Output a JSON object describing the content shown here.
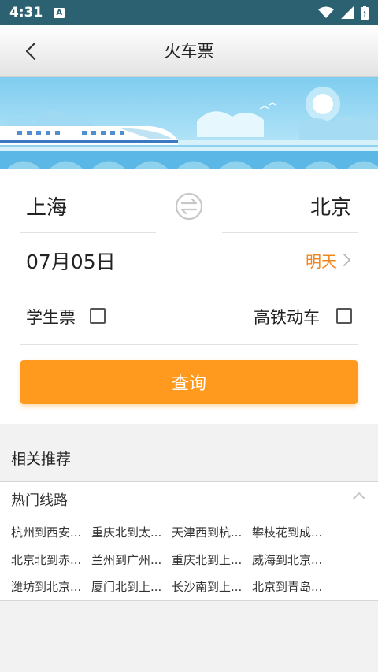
{
  "status_bar": {
    "time": "4:31",
    "notification_icon_letter": "A",
    "icons": [
      "wifi-icon",
      "signal-icon",
      "battery-icon"
    ]
  },
  "header": {
    "title": "火车票",
    "back_icon": "chevron-left-icon"
  },
  "search": {
    "from_city": "上海",
    "to_city": "北京",
    "swap_icon": "swap-arrows-icon",
    "date": "07月05日",
    "day_label": "明天",
    "student_ticket_label": "学生票",
    "student_ticket_checked": false,
    "high_speed_label": "高铁动车",
    "high_speed_checked": false,
    "query_button": "查询"
  },
  "recommend": {
    "title": "相关推荐",
    "hot_routes_title": "热门线路",
    "collapse_icon": "chevron-up-icon",
    "routes": [
      "杭州到西安...",
      "重庆北到太...",
      "天津西到杭...",
      "攀枝花到成...",
      "北京北到赤...",
      "兰州到广州...",
      "重庆北到上...",
      "威海到北京...",
      "潍坊到北京...",
      "厦门北到上...",
      "长沙南到上...",
      "北京到青岛..."
    ]
  },
  "colors": {
    "status_bar": "#2c6171",
    "accent_orange": "#ff9a1e",
    "day_label_orange": "#f0861a",
    "banner_sky": "#8fd2ee"
  }
}
